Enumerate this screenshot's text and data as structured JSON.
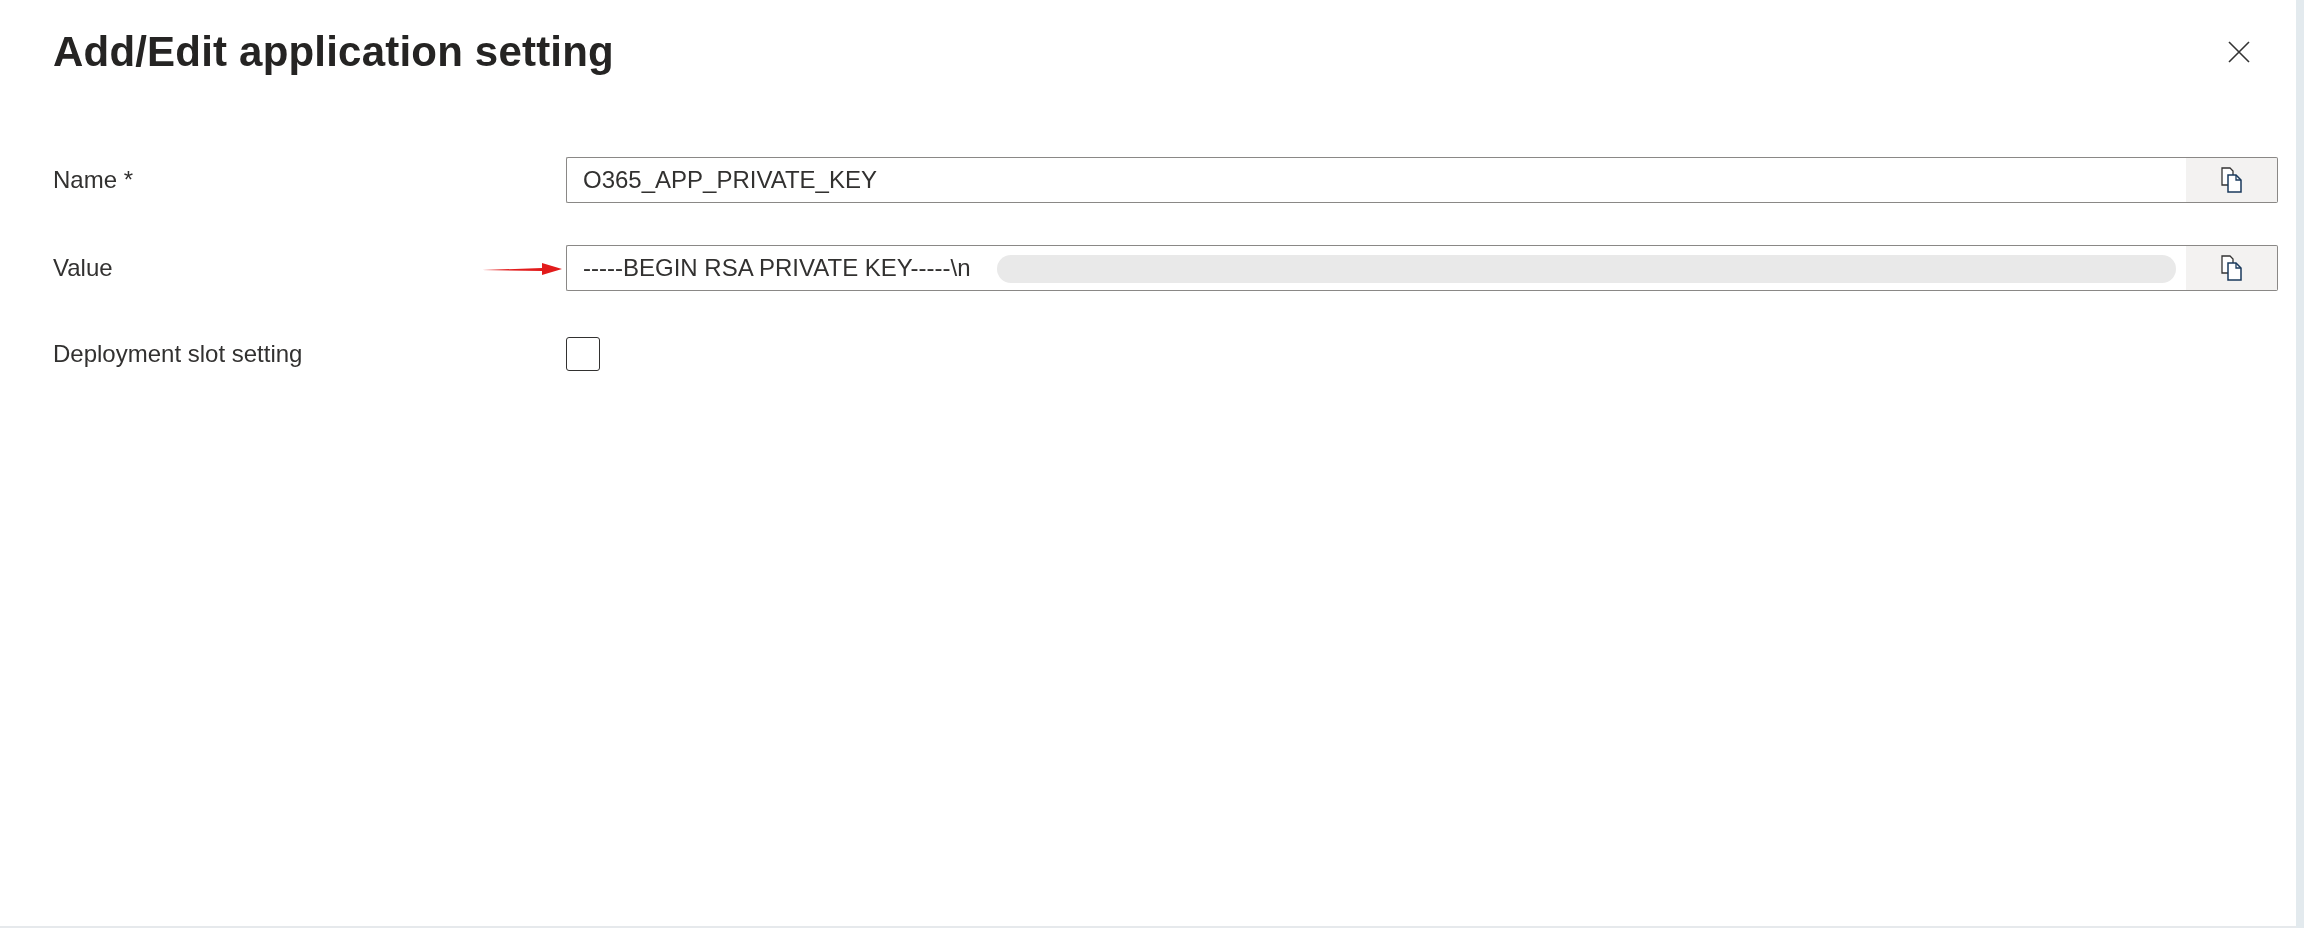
{
  "dialog": {
    "title": "Add/Edit application setting"
  },
  "fields": [
    {
      "kind": "text",
      "label": "Name *",
      "value": "O365_APP_PRIVATE_KEY",
      "redacted": false,
      "arrow": false
    },
    {
      "kind": "text",
      "label": "Value",
      "value": "-----BEGIN RSA PRIVATE KEY-----\\n",
      "redacted": true,
      "arrow": true
    },
    {
      "kind": "checkbox",
      "label": "Deployment slot setting",
      "checked": false
    }
  ]
}
